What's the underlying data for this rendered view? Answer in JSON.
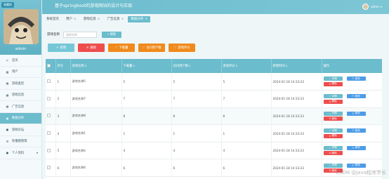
{
  "sidebar": {
    "collect_badge": "收藏的",
    "username": "admin",
    "items": [
      {
        "label": "首页",
        "icon": "home-icon",
        "glyph": "⌂"
      },
      {
        "label": "用户",
        "icon": "grid-icon",
        "glyph": "▦"
      },
      {
        "label": "游戏类型",
        "icon": "grid-icon",
        "glyph": "▦"
      },
      {
        "label": "游戏信息",
        "icon": "grid-icon",
        "glyph": "▦"
      },
      {
        "label": "广告信息",
        "icon": "grid-icon",
        "glyph": "▦"
      },
      {
        "label": "数据分析",
        "icon": "grid-icon",
        "glyph": "▦"
      },
      {
        "label": "游戏论坛",
        "icon": "user-icon",
        "glyph": "●"
      },
      {
        "label": "轮播图管理",
        "icon": "gear-icon",
        "glyph": "⚙"
      },
      {
        "label": "个人资料",
        "icon": "user-icon",
        "glyph": "●"
      }
    ]
  },
  "header": {
    "title": "基于springboot的游戏网站的设计与实现",
    "user": "admin"
  },
  "tabs": [
    "系统首页",
    "用户",
    "游戏信息",
    "广告信息",
    "数据分析"
  ],
  "search": {
    "label": "游戏名称",
    "placeholder": "游戏名称",
    "button": "搜索"
  },
  "actions": {
    "add": "新增",
    "delete": "删除",
    "download": "下载量",
    "per_user": "访问用户数",
    "rating": "游戏评分"
  },
  "table": {
    "headers": [
      "序号",
      "游戏名称",
      "下载量",
      "访问用户数",
      "游戏评分",
      "新增时间",
      "操作"
    ],
    "ops": {
      "detail": "详情",
      "edit": "修改",
      "remove": "删除"
    },
    "rows": [
      {
        "idx": "1",
        "name": "游戏名称5",
        "downloads": "5",
        "users": "5",
        "rating": "5",
        "time": "2024-01-18 14:33:23"
      },
      {
        "idx": "2",
        "name": "游戏名称7",
        "downloads": "7",
        "users": "7",
        "rating": "7",
        "time": "2024-01-18 14:33:23"
      },
      {
        "idx": "3",
        "name": "游戏名称8",
        "downloads": "8",
        "users": "8",
        "rating": "8",
        "time": "2024-01-18 14:33:23"
      },
      {
        "idx": "4",
        "name": "游戏名称1",
        "downloads": "1",
        "users": "1",
        "rating": "1",
        "time": "2024-01-18 14:33:23"
      },
      {
        "idx": "5",
        "name": "游戏名称4",
        "downloads": "4",
        "users": "4",
        "rating": "4",
        "time": "2024-01-18 14:33:23"
      },
      {
        "idx": "6",
        "name": "游戏名称6",
        "downloads": "6",
        "users": "6",
        "rating": "6",
        "time": "2024-01-18 14:33:23"
      }
    ]
  },
  "watermark": "CSDN @Java程序学长",
  "colors": {
    "accent": "#6bbccd",
    "danger": "#ee4d4d",
    "orange": "#f08a1c",
    "edit": "#4c9ce8"
  }
}
